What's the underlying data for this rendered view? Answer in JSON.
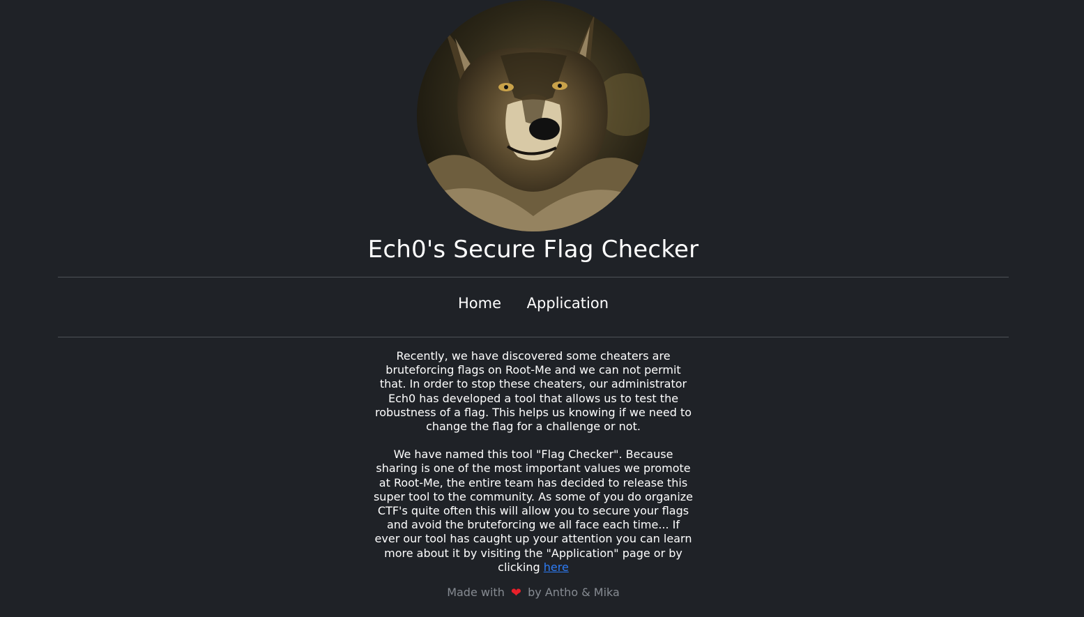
{
  "header": {
    "title": "Ech0's Secure Flag Checker"
  },
  "nav": {
    "items": [
      {
        "label": "Home"
      },
      {
        "label": "Application"
      }
    ]
  },
  "main": {
    "paragraph1": "Recently, we have discovered some cheaters are bruteforcing flags on Root-Me and we can not permit that. In order to stop these cheaters, our administrator Ech0 has developed a tool that allows us to test the robustness of a flag. This helps us knowing if we need to change the flag for a challenge or not.",
    "paragraph2_text": "We have named this tool \"Flag Checker\". Because sharing is one of the most important values we promote at Root-Me, the entire team has decided to release this super tool to the community. As some of you do organize CTF's quite often this will allow you to secure your flags and avoid the bruteforcing we all face each time... If ever our tool has caught up your attention you can learn more about it by visiting the \"Application\" page or by clicking ",
    "link_label": "here"
  },
  "footer": {
    "prefix": "Made with",
    "heart_icon": "heart-icon",
    "suffix": "by Antho & Mika"
  },
  "colors": {
    "background": "#1f2227",
    "link": "#2e7cf6",
    "heart": "#e8202a",
    "footer_text": "#868b92"
  }
}
